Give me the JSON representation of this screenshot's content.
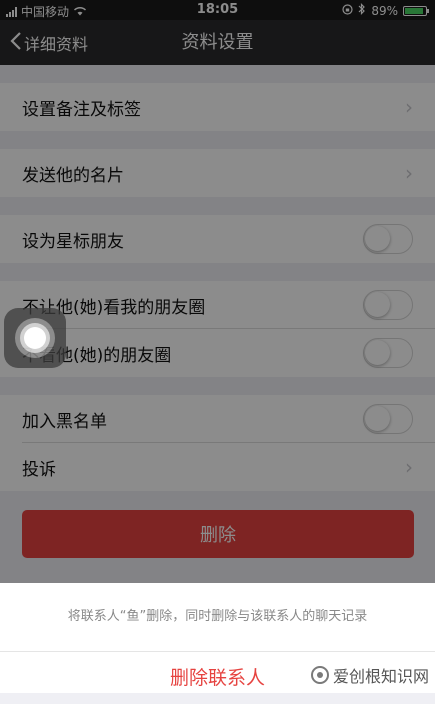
{
  "status_bar": {
    "carrier": "中国移动",
    "time": "18:05",
    "battery": "89%",
    "battery_level": 0.89
  },
  "nav": {
    "back_label": "详细资料",
    "title": "资料设置"
  },
  "cells": {
    "remark_tags": "设置备注及标签",
    "send_card": "发送他的名片",
    "star_friend": "设为星标朋友",
    "hide_my_moments": "不让他(她)看我的朋友圈",
    "hide_their_moments": "不看他(她)的朋友圈",
    "blacklist": "加入黑名单",
    "report": "投诉"
  },
  "toggles": {
    "star_friend": false,
    "hide_my_moments": false,
    "hide_their_moments": false,
    "blacklist": false
  },
  "delete_button": "删除",
  "action_sheet": {
    "message": "将联系人“鱼”删除，同时删除与该联系人的聊天记录",
    "action": "删除联系人"
  },
  "watermark": "爱创根知识网",
  "colors": {
    "danger": "#e64340",
    "nav_bg": "#2b2b2d",
    "battery": "#4cd964"
  }
}
